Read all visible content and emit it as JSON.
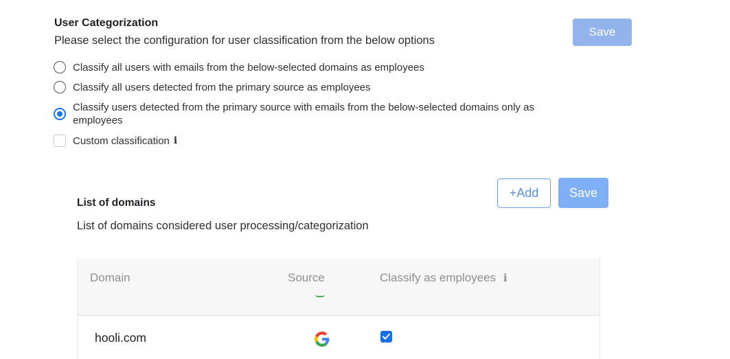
{
  "user_categorization": {
    "title": "User Categorization",
    "description": "Please select the configuration for user classification from the below options",
    "save_label": "Save",
    "options": [
      {
        "label": "Classify all users with emails from the below-selected domains as employees",
        "selected": false
      },
      {
        "label": "Classify all users detected from the primary source as employees",
        "selected": false
      },
      {
        "label": "Classify users detected from the primary source with emails from the below-selected domains only as",
        "label_cont": "employees",
        "selected": true
      }
    ],
    "custom_classification": {
      "label": "Custom classification",
      "checked": false,
      "info_icon": "i"
    }
  },
  "domains": {
    "title": "List of domains",
    "description": "List of domains considered user processing/categorization",
    "add_label": "+Add",
    "save_label": "Save",
    "table": {
      "headers": {
        "domain": "Domain",
        "source": "Source",
        "classify": "Classify as employees",
        "classify_info": "i"
      },
      "rows": [
        {
          "domain": "hooli.com",
          "source_icon": "google-icon",
          "classify_as_employee": true
        }
      ]
    }
  },
  "colors": {
    "accent": "#1a73e8",
    "save_disabled": "#93b3ec",
    "save_domains": "#7fb0f5",
    "add_border": "#6f9fe0"
  }
}
